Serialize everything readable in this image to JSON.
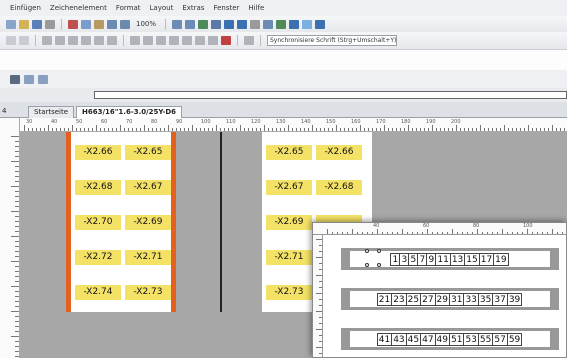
{
  "menu": [
    "Einfügen",
    "Zeichenelement",
    "Format",
    "Layout",
    "Extras",
    "Fenster",
    "Hilfe"
  ],
  "toolbar": {
    "zoom": "100%",
    "font_box": "Synchronisiere Schrift (Strg+Umschalt+Y)"
  },
  "tabs": [
    "Startseite",
    "H663/16\"1.6-3.0/25Y-D6"
  ],
  "ruler_top": [
    "30",
    "40",
    "50",
    "60",
    "70",
    "80",
    "90",
    "100",
    "110",
    "120",
    "130",
    "140",
    "150",
    "160",
    "170",
    "180",
    "190",
    "200"
  ],
  "overlay_ruler": [
    "40",
    "60",
    "80",
    "100"
  ],
  "labels_left": [
    [
      "-X2.66",
      "-X2.65"
    ],
    [
      "-X2.68",
      "-X2.67"
    ],
    [
      "-X2.70",
      "-X2.69"
    ],
    [
      "-X2.72",
      "-X2.71"
    ],
    [
      "-X2.74",
      "-X2.73"
    ]
  ],
  "labels_right": [
    [
      "-X2.65",
      "-X2.66"
    ],
    [
      "-X2.67",
      "-X2.68"
    ],
    [
      "-X2.69",
      ""
    ],
    [
      "-X2.71",
      ""
    ],
    [
      "-X2.73",
      ""
    ]
  ],
  "preview_rows": [
    [
      "1",
      "3",
      "5",
      "7",
      "9",
      "11",
      "13",
      "15",
      "17",
      "19"
    ],
    [
      "21",
      "23",
      "25",
      "27",
      "29",
      "31",
      "33",
      "35",
      "37",
      "39"
    ],
    [
      "41",
      "43",
      "45",
      "47",
      "49",
      "51",
      "53",
      "55",
      "57",
      "59"
    ]
  ],
  "colors": {
    "label_fill": "#f4e267",
    "edge_strip": "#e3601f",
    "canvas_bg": "#a7a7a7"
  }
}
